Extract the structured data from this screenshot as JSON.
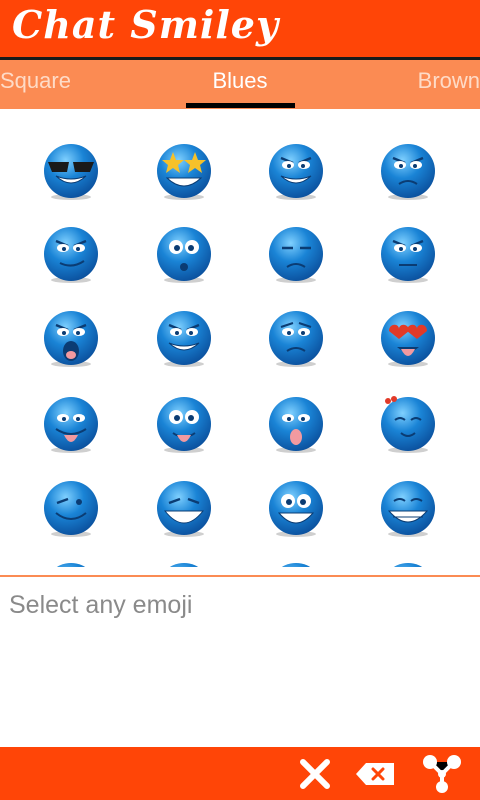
{
  "header": {
    "title": "Chat Smiley"
  },
  "tabs": {
    "items": [
      {
        "label": "Square"
      },
      {
        "label": "Blues"
      },
      {
        "label": "Brown"
      }
    ],
    "selected": "Blues"
  },
  "input": {
    "placeholder": "Select any emoji",
    "value": ""
  },
  "colors": {
    "primary": "#ff4507",
    "tab_bar": "#fb8b53",
    "emoji_blue": "#1a84d6"
  },
  "toolbar": {
    "icons": [
      "close-icon",
      "backspace-icon",
      "share-icon"
    ]
  },
  "emojis": [
    "sunglasses",
    "star-eyes",
    "grin-sly",
    "angry",
    "smirk",
    "shocked",
    "wink-meh",
    "grumpy",
    "yell",
    "grin-angry",
    "worried",
    "heart-eyes",
    "tongue",
    "goofy",
    "tongue-out",
    "in-love",
    "wink",
    "laugh",
    "excited",
    "big-grin"
  ]
}
